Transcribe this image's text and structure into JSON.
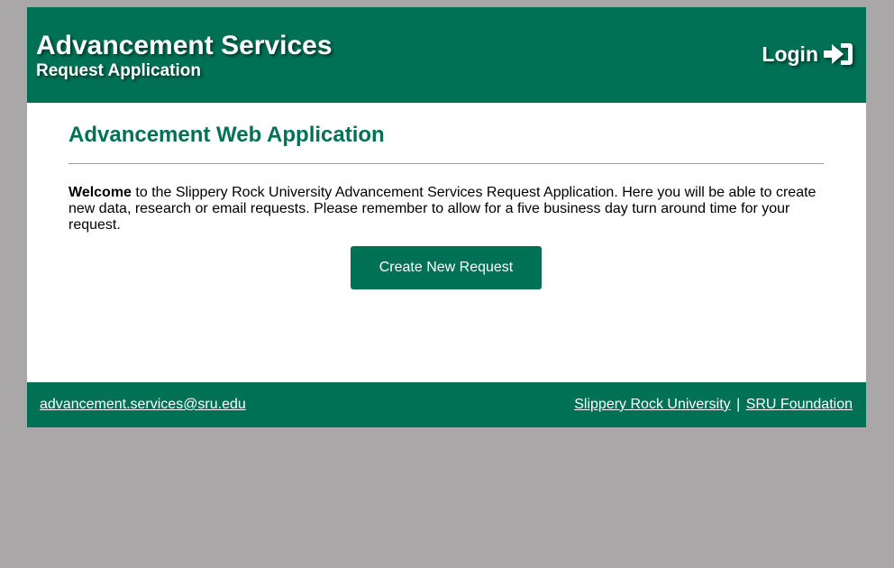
{
  "header": {
    "title": "Advancement Services",
    "subtitle": "Request Application",
    "login_label": "Login",
    "login_icon": "sign-in-icon"
  },
  "main": {
    "heading": "Advancement Web Application",
    "welcome_bold": "Welcome",
    "welcome_text": " to the Slippery Rock University Advancement Services Request Application. Here you will be able to create new data, research or email requests. Please remember to allow for a five business day turn around time for your request.",
    "create_button_label": "Create New Request"
  },
  "footer": {
    "email": "advancement.services@sru.edu",
    "link_university": "Slippery Rock University",
    "separator": "|",
    "link_foundation": "SRU Foundation"
  },
  "colors": {
    "brand_green": "#007155",
    "page_background": "#a9a7a7",
    "content_background": "#ffffff"
  }
}
